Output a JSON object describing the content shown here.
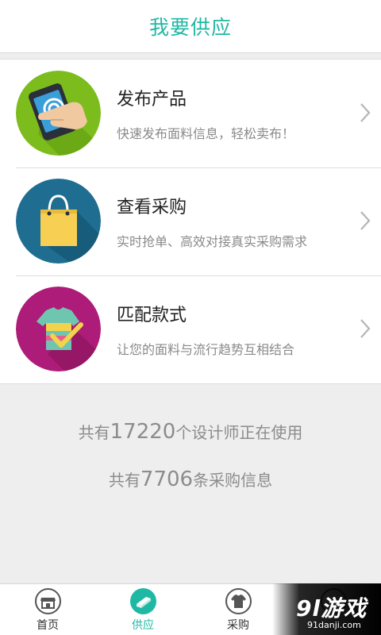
{
  "header": {
    "title": "我要供应"
  },
  "items": [
    {
      "title": "发布产品",
      "subtitle": "快速发布面料信息，轻松卖布！",
      "icon": "tablet-touch-icon",
      "color": "#7cbc1c"
    },
    {
      "title": "查看采购",
      "subtitle": "实时抢单、高效对接真实采购需求",
      "icon": "shopping-bag-icon",
      "color": "#1f6e92"
    },
    {
      "title": "匹配款式",
      "subtitle": "让您的面料与流行趋势互相结合",
      "icon": "tshirt-check-icon",
      "color": "#ad1c78"
    }
  ],
  "stats": {
    "designers": {
      "prefix": "共有",
      "count": "17220",
      "suffix": "个设计师正在使用"
    },
    "purchases": {
      "prefix": "共有",
      "count": "7706",
      "suffix": "条采购信息"
    }
  },
  "tabs": [
    {
      "label": "首页",
      "icon": "storefront-icon"
    },
    {
      "label": "供应",
      "icon": "fabric-roll-icon",
      "active": true
    },
    {
      "label": "采购",
      "icon": "tshirt-icon"
    },
    {
      "label": "",
      "icon": "profile-icon"
    }
  ],
  "watermark": {
    "logo": "9l游戏",
    "url": "91danji.com"
  },
  "colors": {
    "accent": "#1fb8a4",
    "background": "#eeeeee"
  }
}
